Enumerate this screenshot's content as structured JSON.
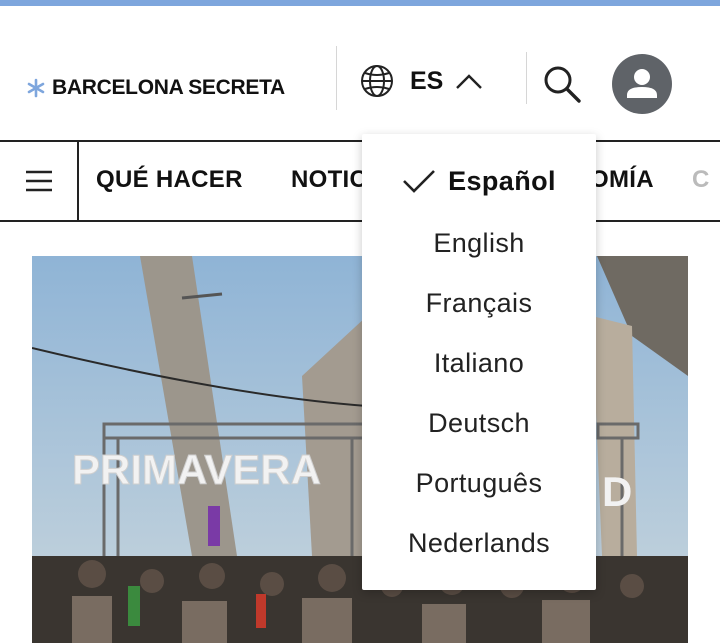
{
  "brand": {
    "name": "BARCELONA SECRETA",
    "accent_color": "#7ea6dd"
  },
  "language_selector": {
    "current": "ES",
    "state": "expanded"
  },
  "nav": {
    "items": [
      "QUÉ HACER",
      "NOTICIAS",
      "GASTRONOMÍA",
      "CULTURA"
    ],
    "visible_items": {
      "que_hacer": "QUÉ HACER",
      "noticias_partial": "NOTIC",
      "gastronomia_partial": "OMÍA",
      "cultura_partial": "C"
    }
  },
  "hero": {
    "sign_text_left": "PRIMAVERA",
    "sign_text_right": "D"
  },
  "dropdown": {
    "options": [
      {
        "label": "Español",
        "selected": true
      },
      {
        "label": "English",
        "selected": false
      },
      {
        "label": "Français",
        "selected": false
      },
      {
        "label": "Italiano",
        "selected": false
      },
      {
        "label": "Deutsch",
        "selected": false
      },
      {
        "label": "Português",
        "selected": false
      },
      {
        "label": "Nederlands",
        "selected": false
      }
    ]
  },
  "icons": {
    "logo": "asterisk-icon",
    "globe": "globe-icon",
    "chevron": "chevron-up-icon",
    "search": "search-icon",
    "avatar": "user-avatar-icon",
    "menu": "hamburger-menu-icon",
    "check": "check-icon"
  },
  "colors": {
    "avatar_bg": "#5f6368",
    "text": "#111111",
    "sky": "#9bbedd"
  }
}
